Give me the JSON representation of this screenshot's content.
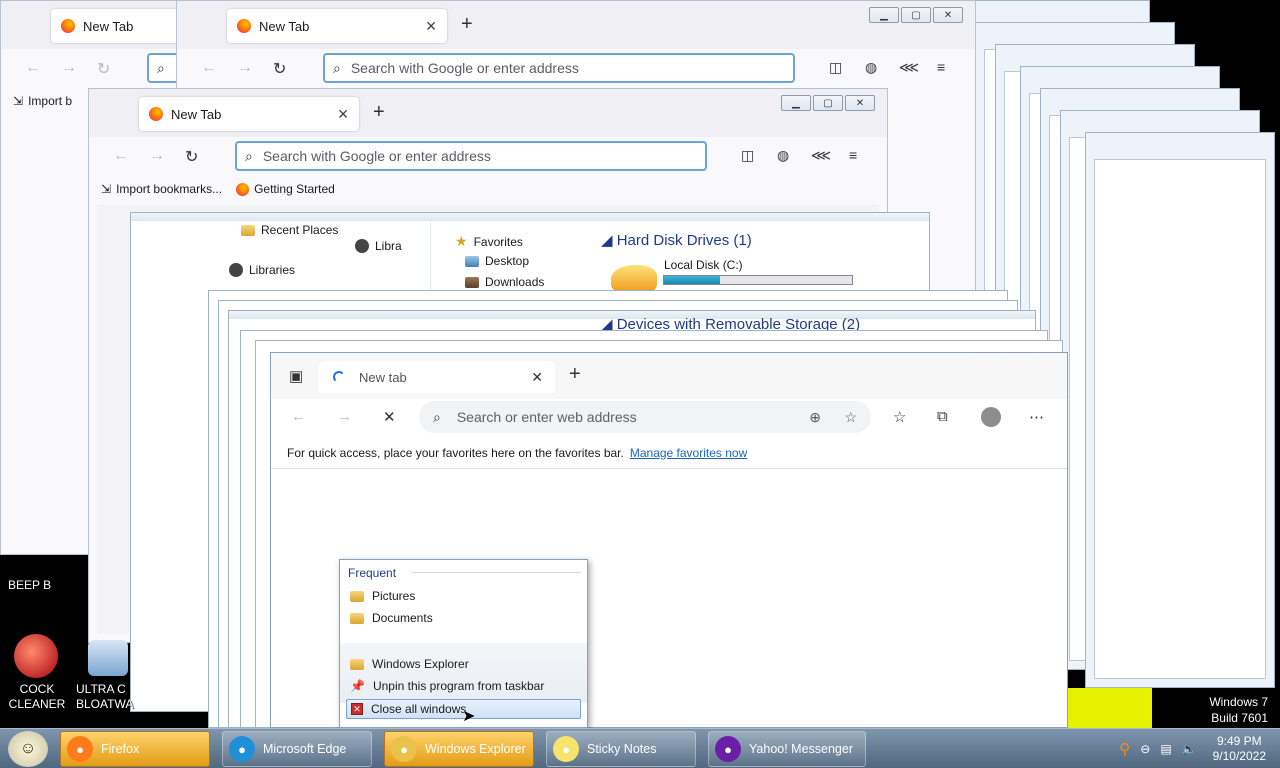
{
  "firefox": {
    "tab_title": "New Tab",
    "new_tab_symbol": "+",
    "address_placeholder": "Search with Google or enter address",
    "bookmarks": {
      "import_label": "Import bookmarks...",
      "import_short": "Import b",
      "getting_started": "Getting Started"
    }
  },
  "explorer": {
    "nav": {
      "favorites": "Favorites",
      "desktop": "Desktop",
      "downloads": "Downloads",
      "recent_places": "Recent Places",
      "libraries": "Libraries",
      "libra": "Libra"
    },
    "hard_disk_header": "Hard Disk Drives (1)",
    "local_disk": "Local Disk (C:)",
    "local_disk_used_fraction": 0.3,
    "removable_header": "Devices with Removable Storage (2)"
  },
  "edge": {
    "tab_title": "New tab",
    "new_tab_symbol": "+",
    "address_placeholder": "Search or enter web address",
    "favbar_text": "For quick access, place your favorites here on the favorites bar.",
    "favbar_link": "Manage favorites now"
  },
  "jump_list": {
    "frequent_header": "Frequent",
    "frequent": [
      "Pictures",
      "Documents"
    ],
    "tasks": [
      "Windows Explorer",
      "Unpin this program from taskbar",
      "Close all windows"
    ]
  },
  "desktop": {
    "icons": [
      {
        "label_line1": "COCK",
        "label_line2": "CLEANER"
      },
      {
        "label_line1": "ULTRA C",
        "label_line2": "BLOATWA"
      }
    ],
    "beep_label": "BEEP B",
    "win_version_line1": "Windows 7",
    "win_version_line2": "Build 7601"
  },
  "taskbar": {
    "buttons": [
      {
        "label": "Firefox",
        "color": "#ff7a1a"
      },
      {
        "label": "Microsoft Edge",
        "color": "#1f8fd8"
      },
      {
        "label": "Windows Explorer",
        "color": "#e8c24a"
      },
      {
        "label": "Sticky Notes",
        "color": "#f5e36c"
      },
      {
        "label": "Yahoo! Messenger",
        "color": "#6b1fa6"
      }
    ],
    "clock_time": "9:49 PM",
    "clock_date": "9/10/2022"
  }
}
